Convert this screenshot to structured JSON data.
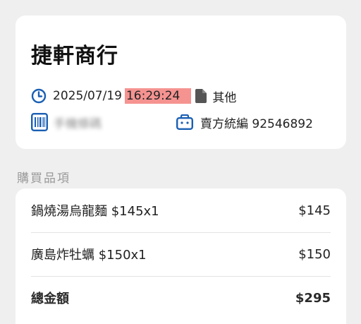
{
  "store": {
    "name": "捷軒商行"
  },
  "invoice": {
    "date": "2025/07/19",
    "time": "16:29:24",
    "type": "其他",
    "carrier": "手機條碼",
    "seller_label": "賣方統編 92546892"
  },
  "items_section": {
    "label": "購買品項",
    "items": [
      {
        "name": "鍋燒湯烏龍麵 $145x1",
        "amount": "$145"
      },
      {
        "name": "廣島炸牡蠣 $150x1",
        "amount": "$150"
      }
    ],
    "total_label": "總金額",
    "total_amount": "$295"
  },
  "icons": {
    "clock": "clock-icon",
    "file": "file-icon",
    "barcode": "barcode-icon",
    "shop": "shop-icon"
  },
  "colors": {
    "accent": "#1a5fb4",
    "highlight": "#f59391",
    "file_icon": "#555555"
  }
}
